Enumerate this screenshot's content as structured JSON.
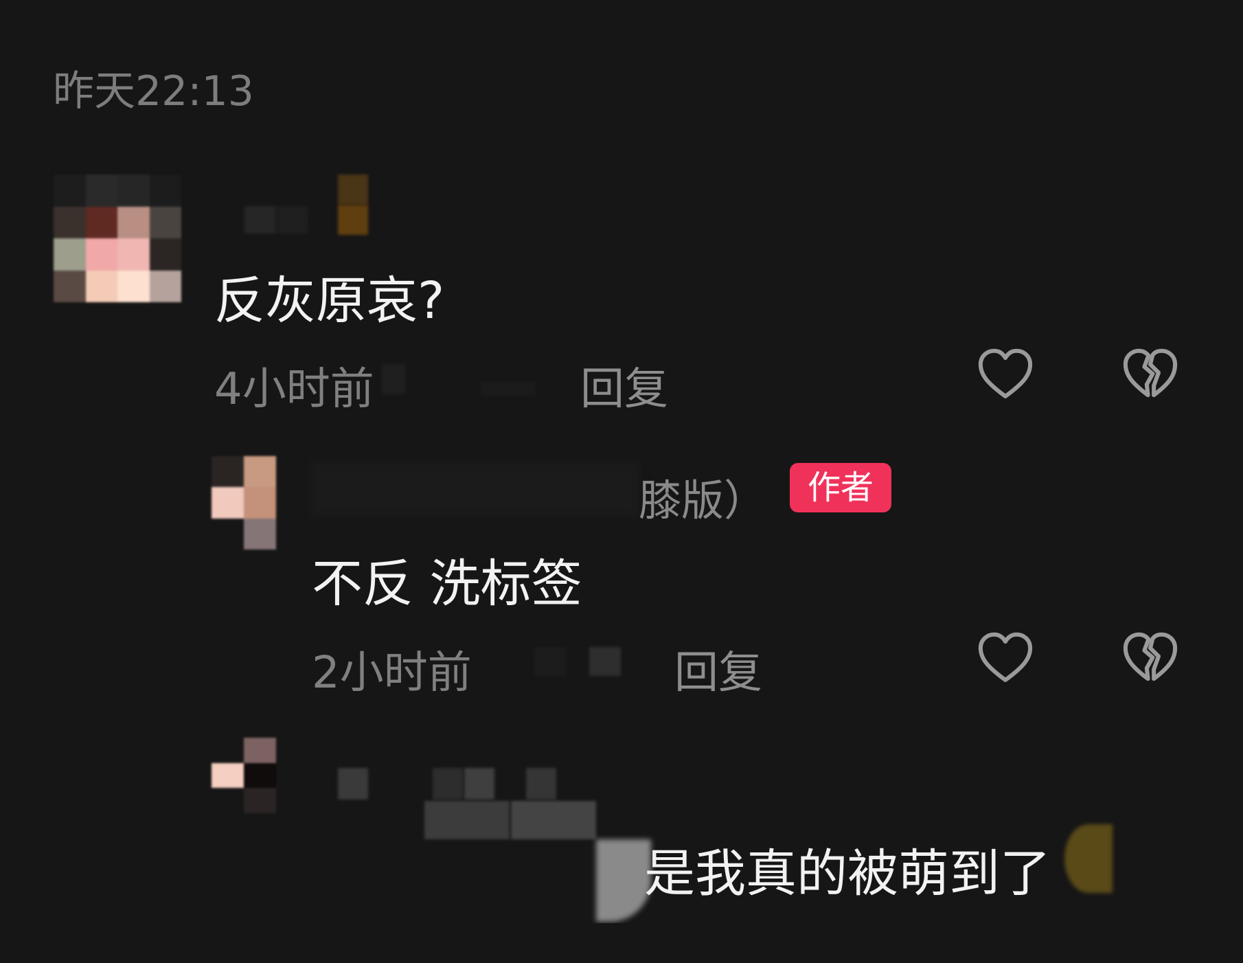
{
  "header": {
    "timestamp": "昨天22:13"
  },
  "comments": [
    {
      "text": "反灰原哀?",
      "time": "4小时前",
      "reply_label": "回复"
    }
  ],
  "replies": [
    {
      "author_name_suffix": "膝版）",
      "badge": "作者",
      "text": "不反 洗标签",
      "time": "2小时前",
      "reply_label": "回复"
    },
    {
      "text": "是我真的被萌到了"
    }
  ],
  "icons": {
    "like": "heart-outline-icon",
    "dislike": "broken-heart-icon"
  },
  "colors": {
    "background": "#161616",
    "badge": "#f0325a",
    "muted_text": "#808080"
  }
}
